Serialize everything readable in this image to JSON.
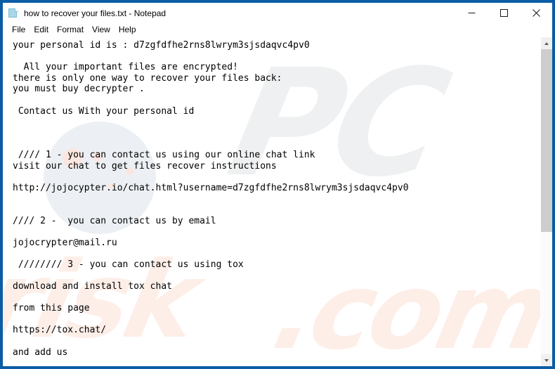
{
  "window": {
    "title": "how to recover your files.txt - Notepad",
    "app_icon": "notepad-document-icon",
    "border_color": "#0b5ca5",
    "controls": {
      "minimize": "minimize-icon",
      "maximize": "maximize-icon",
      "close": "close-icon"
    }
  },
  "menubar": {
    "items": [
      {
        "label": "File"
      },
      {
        "label": "Edit"
      },
      {
        "label": "Format"
      },
      {
        "label": "View"
      },
      {
        "label": "Help"
      }
    ]
  },
  "document": {
    "lines": [
      "your personal id is : d7zgfdfhe2rns8lwrym3sjsdaqvc4pv0",
      "",
      "  All your important files are encrypted!",
      "there is only one way to recover your files back:",
      "you must buy decrypter .",
      "",
      " Contact us With your personal id",
      "",
      "",
      "",
      " //// 1 - you can contact us using our online chat link",
      "visit our chat to get files recover instructions",
      "",
      "http://jojocypter.io/chat.html?username=d7zgfdfhe2rns8lwrym3sjsdaqvc4pv0",
      "",
      "",
      "//// 2 -  you can contact us by email",
      "",
      "jojocrypter@mail.ru",
      "",
      " //////// 3 - you can contact us using tox",
      "",
      "download and install tox chat",
      "",
      "from this page",
      "",
      "https://tox.chat/",
      "",
      "and add us"
    ],
    "personal_id": "d7zgfdfhe2rns8lwrym3sjsdaqvc4pv0",
    "chat_url": "http://jojocypter.io/chat.html?username=d7zgfdfhe2rns8lwrym3sjsdaqvc4pv0",
    "email": "jojocrypter@mail.ru",
    "tox_url": "https://tox.chat/"
  },
  "scrollbar": {
    "up_arrow": "scroll-up-arrow-icon",
    "down_arrow": "scroll-down-arrow-icon",
    "thumb_fraction": "60%"
  },
  "watermark": {
    "primary": "PC",
    "secondary": "risk",
    "tertiary": ".com"
  }
}
